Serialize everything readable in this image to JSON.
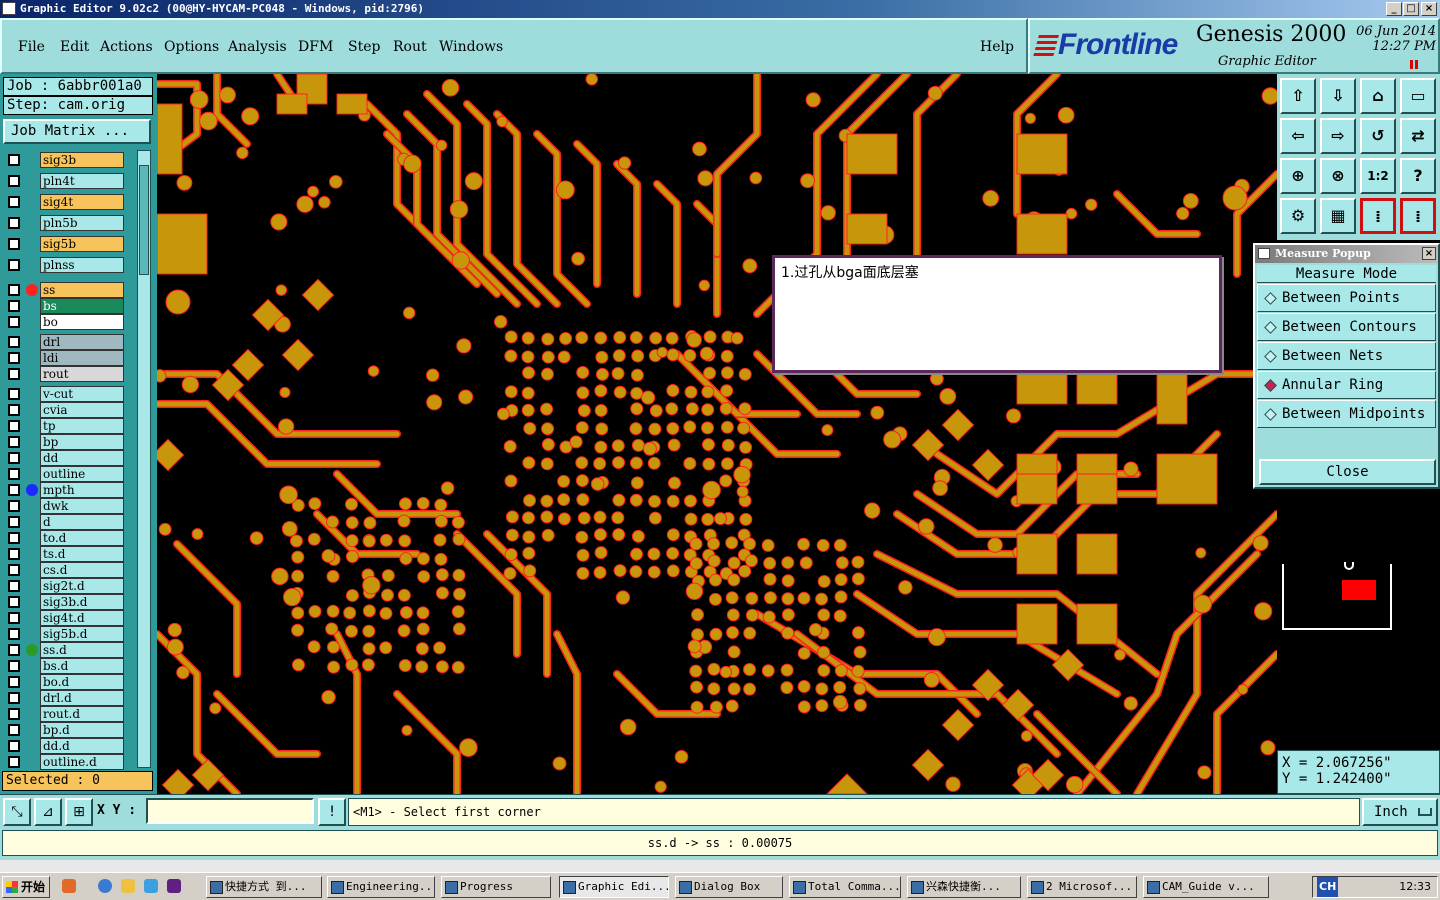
{
  "window": {
    "title": "Graphic Editor 9.02c2 (00@HY-HYCAM-PC048 - Windows, pid:2796)"
  },
  "menu": {
    "items": [
      {
        "label": "File",
        "key": "F"
      },
      {
        "label": "Edit",
        "key": "E"
      },
      {
        "label": "Actions",
        "key": "A"
      },
      {
        "label": "Options",
        "key": "O"
      },
      {
        "label": "Analysis",
        "key": "A"
      },
      {
        "label": "DFM",
        "key": "D"
      },
      {
        "label": "Step",
        "key": "S"
      },
      {
        "label": "Rout",
        "key": "R"
      },
      {
        "label": "Windows",
        "key": "W"
      }
    ],
    "help": "Help"
  },
  "brand": {
    "logo": "Frontline",
    "product": "Genesis 2000",
    "date": "06 Jun 2014",
    "time": "12:27 PM",
    "subtitle": "Graphic Editor"
  },
  "job": {
    "job_label": "Job  :  6abbr001a0",
    "step_label": "Step: cam.orig",
    "matrix_button": "Job Matrix ..."
  },
  "layers": [
    {
      "name": "sig3b",
      "color": "#f6c45a",
      "dot": ""
    },
    {
      "name": "pln4t",
      "color": "#a8e8e8",
      "dot": ""
    },
    {
      "name": "sig4t",
      "color": "#f6c45a",
      "dot": ""
    },
    {
      "name": "pln5b",
      "color": "#a8e8e8",
      "dot": ""
    },
    {
      "name": "sig5b",
      "color": "#f6c45a",
      "dot": ""
    },
    {
      "name": "plnss",
      "color": "#a8e8e8",
      "dot": ""
    },
    {
      "name": "ss",
      "color": "#f6c45a",
      "dot": "#ff2020"
    },
    {
      "name": "bs",
      "color": "#1a8a5a",
      "dot": ""
    },
    {
      "name": "bo",
      "color": "#ffffff",
      "dot": ""
    },
    {
      "name": "drl",
      "color": "#a0b8c0",
      "dot": ""
    },
    {
      "name": "ldi",
      "color": "#a0b8c0",
      "dot": ""
    },
    {
      "name": "rout",
      "color": "#d8d8d8",
      "dot": ""
    },
    {
      "name": "v-cut",
      "color": "#a8e8e8",
      "dot": ""
    },
    {
      "name": "cvia",
      "color": "#a8e8e8",
      "dot": ""
    },
    {
      "name": "tp",
      "color": "#a8e8e8",
      "dot": ""
    },
    {
      "name": "bp",
      "color": "#a8e8e8",
      "dot": ""
    },
    {
      "name": "dd",
      "color": "#a8e8e8",
      "dot": ""
    },
    {
      "name": "outline",
      "color": "#a8e8e8",
      "dot": ""
    },
    {
      "name": "mpth",
      "color": "#a8e8e8",
      "dot": "#1a2aff"
    },
    {
      "name": "dwk",
      "color": "#a8e8e8",
      "dot": ""
    },
    {
      "name": "d",
      "color": "#a8e8e8",
      "dot": ""
    },
    {
      "name": "to.d",
      "color": "#a8e8e8",
      "dot": ""
    },
    {
      "name": "ts.d",
      "color": "#a8e8e8",
      "dot": ""
    },
    {
      "name": "cs.d",
      "color": "#a8e8e8",
      "dot": ""
    },
    {
      "name": "sig2t.d",
      "color": "#a8e8e8",
      "dot": ""
    },
    {
      "name": "sig3b.d",
      "color": "#a8e8e8",
      "dot": ""
    },
    {
      "name": "sig4t.d",
      "color": "#a8e8e8",
      "dot": ""
    },
    {
      "name": "sig5b.d",
      "color": "#a8e8e8",
      "dot": ""
    },
    {
      "name": "ss.d",
      "color": "#a8e8e8",
      "dot": "#2a9a2a"
    },
    {
      "name": "bs.d",
      "color": "#a8e8e8",
      "dot": ""
    },
    {
      "name": "bo.d",
      "color": "#a8e8e8",
      "dot": ""
    },
    {
      "name": "drl.d",
      "color": "#a8e8e8",
      "dot": ""
    },
    {
      "name": "rout.d",
      "color": "#a8e8e8",
      "dot": ""
    },
    {
      "name": "bp.d",
      "color": "#a8e8e8",
      "dot": ""
    },
    {
      "name": "dd.d",
      "color": "#a8e8e8",
      "dot": ""
    },
    {
      "name": "outline.d",
      "color": "#a8e8e8",
      "dot": ""
    }
  ],
  "selected_label": "Selected : 0",
  "note": {
    "text": "1.过孔从bga面底层塞"
  },
  "measure": {
    "title": "Measure Popup",
    "mode_label": "Measure Mode",
    "options": [
      {
        "label": "Between Points",
        "selected": false
      },
      {
        "label": "Between Contours",
        "selected": false
      },
      {
        "label": "Between Nets",
        "selected": false
      },
      {
        "label": "Annular Ring",
        "selected": true
      },
      {
        "label": "Between Midpoints",
        "selected": false
      }
    ],
    "close": "Close"
  },
  "coords": {
    "x": "X  =  2.067256\"",
    "y": "Y  =  1.242400\""
  },
  "status": {
    "xy_label": "X Y :",
    "xy_value": "",
    "prompt": "<M1> - Select first corner",
    "unit": "Inch",
    "info": "ss.d -> ss : 0.00075"
  },
  "taskbar": {
    "start": "开始",
    "buttons": [
      "快捷方式 到...",
      "Engineering...",
      "Progress",
      "Graphic Edi...",
      "Dialog Box",
      "Total Comma...",
      "兴森快捷衡...",
      "2 Microsof...",
      "CAM_Guide v..."
    ],
    "active": 3,
    "lang": "CH",
    "clock": "12:33"
  },
  "colors": {
    "copper": "#c8960a",
    "pad_outline": "#ff2020",
    "panel": "#9fdcdc",
    "panel_light": "#a8e8e8"
  }
}
